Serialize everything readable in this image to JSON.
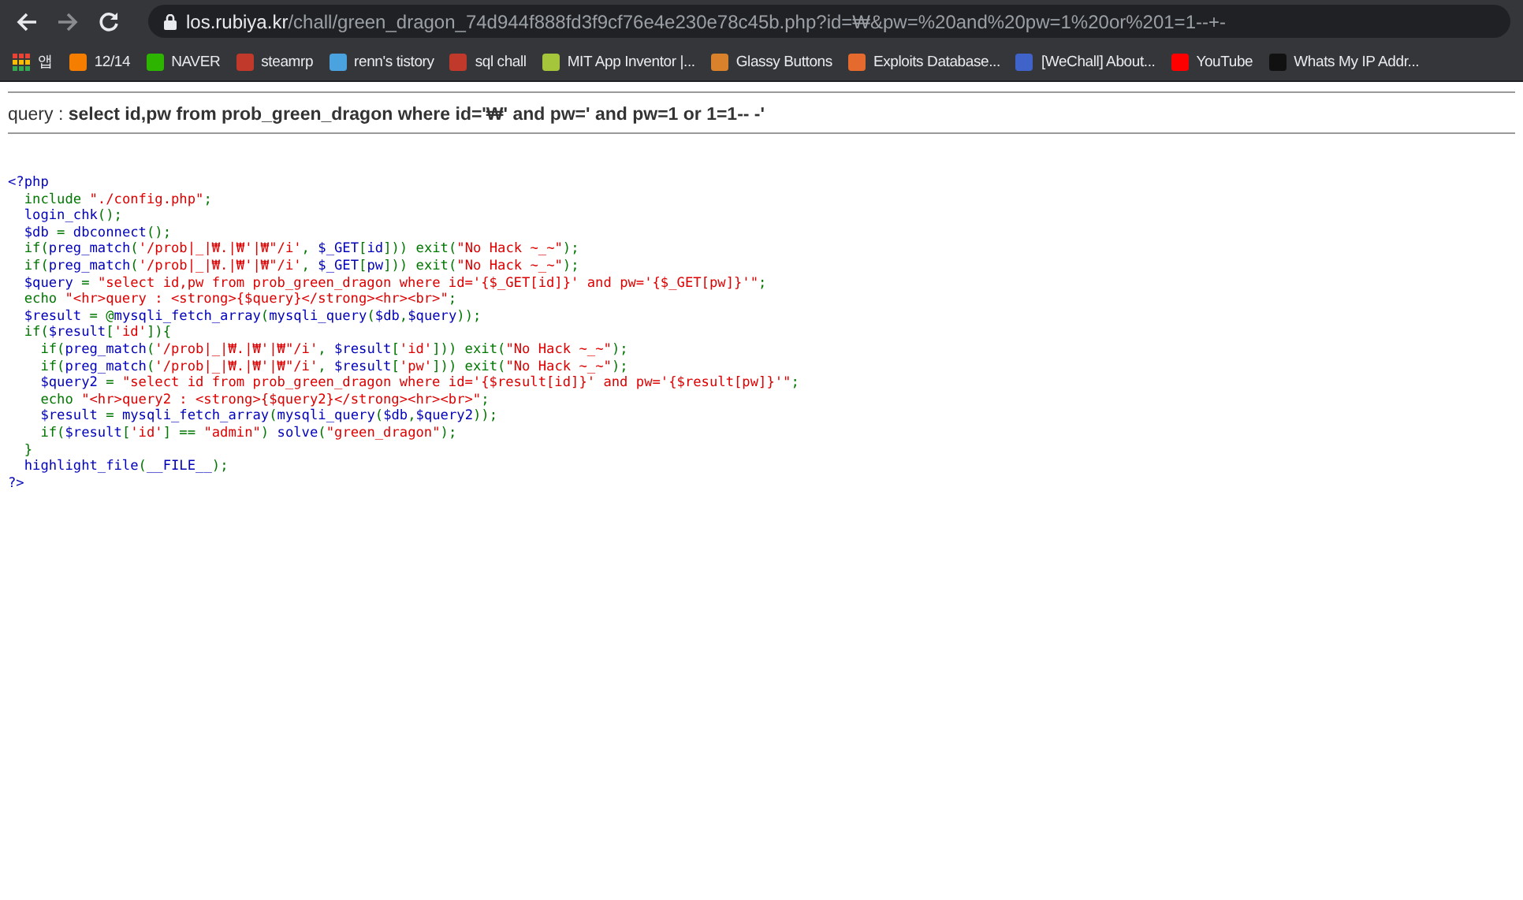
{
  "browser": {
    "address": {
      "host": "los.rubiya.kr",
      "path": "/chall/green_dragon_74d944f888fd3f9cf76e4e230e78c45b.php?id=₩&pw=%20and%20pw=1%20or%201=1--+-"
    },
    "bookmarks": [
      {
        "label": "앱",
        "kind": "apps"
      },
      {
        "label": "12/14",
        "kind": "site",
        "color": "#f57d00"
      },
      {
        "label": "NAVER",
        "kind": "site",
        "color": "#2db400"
      },
      {
        "label": "steamrp",
        "kind": "site",
        "color": "#c0392b"
      },
      {
        "label": "renn's tistory",
        "kind": "site",
        "color": "#4aa3df"
      },
      {
        "label": "sql chall",
        "kind": "site",
        "color": "#c0392b"
      },
      {
        "label": "MIT App Inventor |...",
        "kind": "site",
        "color": "#a5c63b"
      },
      {
        "label": "Glassy Buttons",
        "kind": "site",
        "color": "#d9822b"
      },
      {
        "label": "Exploits Database...",
        "kind": "site",
        "color": "#e46a2e"
      },
      {
        "label": "[WeChall] About...",
        "kind": "site",
        "color": "#3f63c8"
      },
      {
        "label": "YouTube",
        "kind": "site",
        "color": "#ff0000"
      },
      {
        "label": "Whats My IP Addr...",
        "kind": "site",
        "color": "#111111"
      }
    ]
  },
  "page": {
    "query": "query : **select id,pw from prob_green_dragon where id='₩' and pw=' and pw=1 or 1=1-- -'**",
    "source_lines": [
      [
        {
          "kind": "plain",
          "text": "<?php"
        }
      ],
      [
        {
          "kind": "keyword",
          "text": "  include "
        },
        {
          "kind": "string",
          "text": "\"./config.php\""
        },
        {
          "kind": "keyword",
          "text": ";"
        }
      ],
      [
        {
          "kind": "plain",
          "text": "  login_chk"
        },
        {
          "kind": "keyword",
          "text": "();"
        }
      ],
      [
        {
          "kind": "plain",
          "text": "  $db "
        },
        {
          "kind": "keyword",
          "text": "= "
        },
        {
          "kind": "plain",
          "text": "dbconnect"
        },
        {
          "kind": "keyword",
          "text": "();"
        }
      ],
      [
        {
          "kind": "keyword",
          "text": "  if("
        },
        {
          "kind": "plain",
          "text": "preg_match"
        },
        {
          "kind": "keyword",
          "text": "("
        },
        {
          "kind": "string",
          "text": "'/prob|_|₩.|₩'|₩\"/i'"
        },
        {
          "kind": "keyword",
          "text": ", "
        },
        {
          "kind": "plain",
          "text": "$_GET"
        },
        {
          "kind": "keyword",
          "text": "["
        },
        {
          "kind": "plain",
          "text": "id"
        },
        {
          "kind": "keyword",
          "text": "])) exit("
        },
        {
          "kind": "string",
          "text": "\"No Hack ~_~\""
        },
        {
          "kind": "keyword",
          "text": ");"
        }
      ],
      [
        {
          "kind": "keyword",
          "text": "  if("
        },
        {
          "kind": "plain",
          "text": "preg_match"
        },
        {
          "kind": "keyword",
          "text": "("
        },
        {
          "kind": "string",
          "text": "'/prob|_|₩.|₩'|₩\"/i'"
        },
        {
          "kind": "keyword",
          "text": ", "
        },
        {
          "kind": "plain",
          "text": "$_GET"
        },
        {
          "kind": "keyword",
          "text": "["
        },
        {
          "kind": "plain",
          "text": "pw"
        },
        {
          "kind": "keyword",
          "text": "])) exit("
        },
        {
          "kind": "string",
          "text": "\"No Hack ~_~\""
        },
        {
          "kind": "keyword",
          "text": ");"
        }
      ],
      [
        {
          "kind": "plain",
          "text": "  $query "
        },
        {
          "kind": "keyword",
          "text": "= "
        },
        {
          "kind": "string",
          "text": "\"select id,pw from prob_green_dragon where id='{$_GET[id]}' and pw='{$_GET[pw]}'\""
        },
        {
          "kind": "keyword",
          "text": ";"
        }
      ],
      [
        {
          "kind": "keyword",
          "text": "  echo "
        },
        {
          "kind": "string",
          "text": "\"<hr>query : <strong>{$query}</strong><hr><br>\""
        },
        {
          "kind": "keyword",
          "text": ";"
        }
      ],
      [
        {
          "kind": "plain",
          "text": "  $result "
        },
        {
          "kind": "keyword",
          "text": "= @"
        },
        {
          "kind": "plain",
          "text": "mysqli_fetch_array"
        },
        {
          "kind": "keyword",
          "text": "("
        },
        {
          "kind": "plain",
          "text": "mysqli_query"
        },
        {
          "kind": "keyword",
          "text": "("
        },
        {
          "kind": "plain",
          "text": "$db"
        },
        {
          "kind": "keyword",
          "text": ","
        },
        {
          "kind": "plain",
          "text": "$query"
        },
        {
          "kind": "keyword",
          "text": "));"
        }
      ],
      [
        {
          "kind": "keyword",
          "text": "  if("
        },
        {
          "kind": "plain",
          "text": "$result"
        },
        {
          "kind": "keyword",
          "text": "["
        },
        {
          "kind": "string",
          "text": "'id'"
        },
        {
          "kind": "keyword",
          "text": "]){"
        }
      ],
      [
        {
          "kind": "keyword",
          "text": "    if("
        },
        {
          "kind": "plain",
          "text": "preg_match"
        },
        {
          "kind": "keyword",
          "text": "("
        },
        {
          "kind": "string",
          "text": "'/prob|_|₩.|₩'|₩\"/i'"
        },
        {
          "kind": "keyword",
          "text": ", "
        },
        {
          "kind": "plain",
          "text": "$result"
        },
        {
          "kind": "keyword",
          "text": "["
        },
        {
          "kind": "string",
          "text": "'id'"
        },
        {
          "kind": "keyword",
          "text": "])) exit("
        },
        {
          "kind": "string",
          "text": "\"No Hack ~_~\""
        },
        {
          "kind": "keyword",
          "text": ");"
        }
      ],
      [
        {
          "kind": "keyword",
          "text": "    if("
        },
        {
          "kind": "plain",
          "text": "preg_match"
        },
        {
          "kind": "keyword",
          "text": "("
        },
        {
          "kind": "string",
          "text": "'/prob|_|₩.|₩'|₩\"/i'"
        },
        {
          "kind": "keyword",
          "text": ", "
        },
        {
          "kind": "plain",
          "text": "$result"
        },
        {
          "kind": "keyword",
          "text": "["
        },
        {
          "kind": "string",
          "text": "'pw'"
        },
        {
          "kind": "keyword",
          "text": "])) exit("
        },
        {
          "kind": "string",
          "text": "\"No Hack ~_~\""
        },
        {
          "kind": "keyword",
          "text": ");"
        }
      ],
      [
        {
          "kind": "plain",
          "text": "    $query2 "
        },
        {
          "kind": "keyword",
          "text": "= "
        },
        {
          "kind": "string",
          "text": "\"select id from prob_green_dragon where id='{$result[id]}' and pw='{$result[pw]}'\""
        },
        {
          "kind": "keyword",
          "text": ";"
        }
      ],
      [
        {
          "kind": "keyword",
          "text": "    echo "
        },
        {
          "kind": "string",
          "text": "\"<hr>query2 : <strong>{$query2}</strong><hr><br>\""
        },
        {
          "kind": "keyword",
          "text": ";"
        }
      ],
      [
        {
          "kind": "plain",
          "text": "    $result "
        },
        {
          "kind": "keyword",
          "text": "= "
        },
        {
          "kind": "plain",
          "text": "mysqli_fetch_array"
        },
        {
          "kind": "keyword",
          "text": "("
        },
        {
          "kind": "plain",
          "text": "mysqli_query"
        },
        {
          "kind": "keyword",
          "text": "("
        },
        {
          "kind": "plain",
          "text": "$db"
        },
        {
          "kind": "keyword",
          "text": ","
        },
        {
          "kind": "plain",
          "text": "$query2"
        },
        {
          "kind": "keyword",
          "text": "));"
        }
      ],
      [
        {
          "kind": "keyword",
          "text": "    if("
        },
        {
          "kind": "plain",
          "text": "$result"
        },
        {
          "kind": "keyword",
          "text": "["
        },
        {
          "kind": "string",
          "text": "'id'"
        },
        {
          "kind": "keyword",
          "text": "] == "
        },
        {
          "kind": "string",
          "text": "\"admin\""
        },
        {
          "kind": "keyword",
          "text": ") "
        },
        {
          "kind": "plain",
          "text": "solve"
        },
        {
          "kind": "keyword",
          "text": "("
        },
        {
          "kind": "string",
          "text": "\"green_dragon\""
        },
        {
          "kind": "keyword",
          "text": ");"
        }
      ],
      [
        {
          "kind": "keyword",
          "text": "  }"
        }
      ],
      [
        {
          "kind": "plain",
          "text": "  highlight_file"
        },
        {
          "kind": "keyword",
          "text": "("
        },
        {
          "kind": "plain",
          "text": "__FILE__"
        },
        {
          "kind": "keyword",
          "text": ");"
        }
      ],
      [
        {
          "kind": "plain",
          "text": "?>"
        }
      ]
    ]
  }
}
